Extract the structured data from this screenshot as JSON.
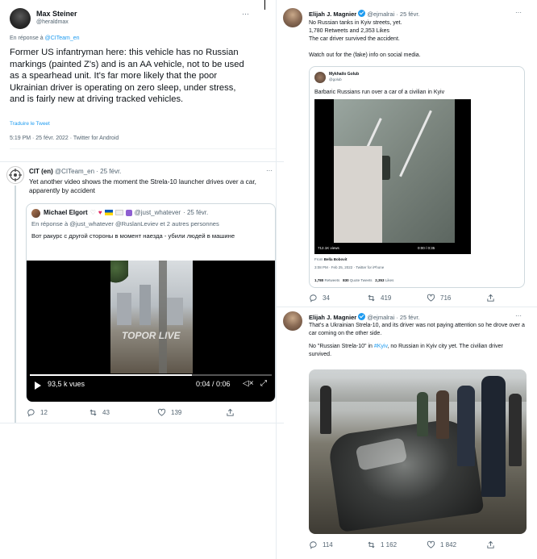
{
  "left": {
    "main_tweet": {
      "author_name": "Max Steiner",
      "author_handle": "@heraldmax",
      "more": "···",
      "reply_to_prefix": "En réponse à",
      "reply_to_handle": "@CITeam_en",
      "text": "Former US infantryman here: this vehicle has no Russian markings (painted Z's) and is an AA vehicle, not to be used as a spearhead unit. It's far more likely that the poor Ukrainian driver is operating on zero sleep, under stress, and is fairly new at driving tracked vehicles.",
      "translate": "Traduire le Tweet",
      "meta": "5:19 PM · 25 févr. 2022 · Twitter for Android"
    },
    "cit_tweet": {
      "author_name": "CIT (en)",
      "author_handle": "@CITeam_en",
      "date": "· 25 févr.",
      "more": "···",
      "text": "Yet another video shows the moment the Strela-10 launcher drives over a car, apparently by accident",
      "quote": {
        "author_name": "Michael Elgort",
        "author_handle": "@just_whatever",
        "date": "· 25 févr.",
        "reply_line": "En réponse à @just_whatever @RuslanLeviev  et 2 autres personnes",
        "text": "Вот ракурс с другой стороны в момент наезда - убили людей в машине",
        "video_views": "93,5 k vues",
        "video_time": "0:04 / 0:06",
        "watermark": "TOPOR LIVE"
      },
      "replies": "12",
      "retweets": "43",
      "likes": "139"
    }
  },
  "right": {
    "magnier_tweet_1": {
      "author_name": "Elijah J. Magnier",
      "author_handle": "@ejmalrai",
      "date": "· 25 févr.",
      "more": "···",
      "line1": "No Russian tanks in Kyiv streets, yet.",
      "line2": "1,780 Retweets and 2,353 Likes",
      "line3": "The car driver survived the accident.",
      "line4": "Watch out for the (fake) info on social media.",
      "embed": {
        "author_name": "Mykhailo Golub",
        "author_handle": "@golub",
        "text": "Barbaric Russians run over a car of a civilian in Kyiv",
        "views": "712.1K views",
        "time": "0:00 / 0:35",
        "from": "From",
        "from_name": "Bella Bobovit",
        "meta": "3:08 PM · Feb 25, 2022 · Twitter for iPhone",
        "retweets": "1,780",
        "retweets_label": "Retweets",
        "quotes": "830",
        "quotes_label": "Quote Tweets",
        "likes": "2,353",
        "likes_label": "Likes"
      },
      "replies": "34",
      "retweets": "419",
      "likes": "716"
    },
    "magnier_tweet_2": {
      "author_name": "Elijah J. Magnier",
      "author_handle": "@ejmalrai",
      "date": "· 25 févr.",
      "more": "···",
      "line1": "That's a Ukrainian Strela-10, and its driver was not paying attention so he drove over a car coming on the other side.",
      "line2_prefix": "No \"Russian Strela-10\" in ",
      "line2_hashtag": "#Kyiv",
      "line2_suffix": ", no Russian in Kyiv city yet. The civilian driver survived.",
      "replies": "114",
      "retweets": "1 162",
      "likes": "1 842"
    }
  },
  "colors": {
    "link": "#1d9bf0",
    "muted": "#536471",
    "border": "#cfd9de",
    "like_red": "#e0245e",
    "ukraine_blue": "#0057b7",
    "ukraine_yellow": "#ffd700"
  }
}
